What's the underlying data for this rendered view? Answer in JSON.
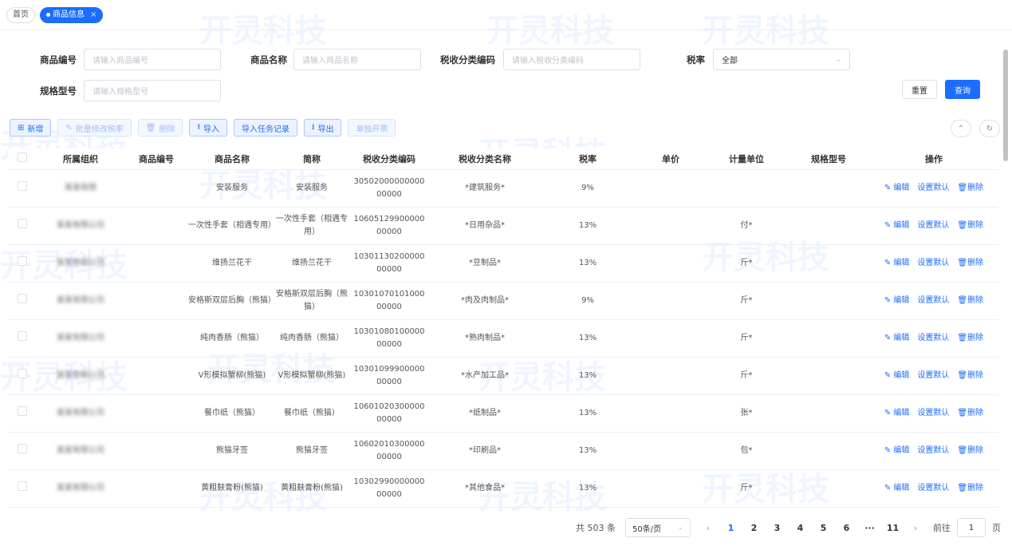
{
  "tabs": [
    {
      "label": "首页"
    },
    {
      "label": "商品信息",
      "close": "×"
    }
  ],
  "search": {
    "product_code": {
      "label": "商品编号",
      "placeholder": "请输入商品编号"
    },
    "product_name": {
      "label": "商品名称",
      "placeholder": "请输入商品名称"
    },
    "tax_code": {
      "label": "税收分类编码",
      "placeholder": "请输入税收分类编码"
    },
    "tax_rate": {
      "label": "税率",
      "value": "全部"
    },
    "spec": {
      "label": "规格型号",
      "placeholder": "请输入规格型号"
    },
    "reset_label": "重置",
    "query_label": "查询"
  },
  "toolbar": {
    "add": "新增",
    "batch_edit_tax": "批量修改税率",
    "delete": "删除",
    "import": "导入",
    "import_log": "导入任务记录",
    "export": "导出",
    "single_invoice": "单独开票"
  },
  "table": {
    "columns": [
      "所属组织",
      "商品编号",
      "商品名称",
      "简称",
      "税收分类编码",
      "税收分类名称",
      "税率",
      "单价",
      "计量单位",
      "规格型号",
      "操作"
    ],
    "op_edit": "编辑",
    "op_default": "设置默认",
    "op_delete": "删除",
    "rows": [
      {
        "org": "某某有限",
        "name": "安装服务",
        "short": "安装服务",
        "code1": "30502000000000",
        "code2": "00000",
        "tax_name": "*建筑服务*",
        "rate": "9%",
        "unit": ""
      },
      {
        "org": "某某有限公司",
        "name": "一次性手套（相遇专用）",
        "short": "一次性手套（相遇专用）",
        "code1": "10605129900000",
        "code2": "00000",
        "tax_name": "*日用杂品*",
        "rate": "13%",
        "unit": "付*"
      },
      {
        "org": "某某有限公司",
        "name": "维扬兰花干",
        "short": "维扬兰花干",
        "code1": "10301130200000",
        "code2": "00000",
        "tax_name": "*豆制品*",
        "rate": "13%",
        "unit": "斤*"
      },
      {
        "org": "某某有限公司",
        "name": "安格斯双层后胸（熊猫）",
        "short": "安格斯双层后胸（熊猫）",
        "code1": "10301070101000",
        "code2": "00000",
        "tax_name": "*肉及肉制品*",
        "rate": "9%",
        "unit": "斤*"
      },
      {
        "org": "某某有限公司",
        "name": "纯肉香肠（熊猫）",
        "short": "纯肉香肠（熊猫）",
        "code1": "10301080100000",
        "code2": "00000",
        "tax_name": "*熟肉制品*",
        "rate": "13%",
        "unit": "斤*"
      },
      {
        "org": "某某有限公司",
        "name": "V形模拟蟹柳(熊猫)",
        "short": "V形模拟蟹柳(熊猫)",
        "code1": "10301099900000",
        "code2": "00000",
        "tax_name": "*水产加工品*",
        "rate": "13%",
        "unit": "斤*"
      },
      {
        "org": "某某有限公司",
        "name": "餐巾纸（熊猫）",
        "short": "餐巾纸（熊猫）",
        "code1": "10601020300000",
        "code2": "00000",
        "tax_name": "*纸制品*",
        "rate": "13%",
        "unit": "张*"
      },
      {
        "org": "某某有限公司",
        "name": "熊猫牙签",
        "short": "熊猫牙签",
        "code1": "10602010300000",
        "code2": "00000",
        "tax_name": "*印刷品*",
        "rate": "13%",
        "unit": "包*"
      },
      {
        "org": "某某有限公司",
        "name": "黄粗麸膏粉(熊猫)",
        "short": "黄粗麸膏粉(熊猫)",
        "code1": "10302990000000",
        "code2": "00000",
        "tax_name": "*其他食品*",
        "rate": "13%",
        "unit": "斤*"
      }
    ]
  },
  "pagination": {
    "total": "共 503 条",
    "page_size": "50条/页",
    "pages": [
      "1",
      "2",
      "3",
      "4",
      "5",
      "6",
      "···",
      "11"
    ],
    "current": "1",
    "goto_label": "前往",
    "goto_value": "1",
    "page_suffix": "页"
  },
  "watermark": {
    "main": "开灵科技",
    "sub": "KAILINGTECH.COM"
  }
}
